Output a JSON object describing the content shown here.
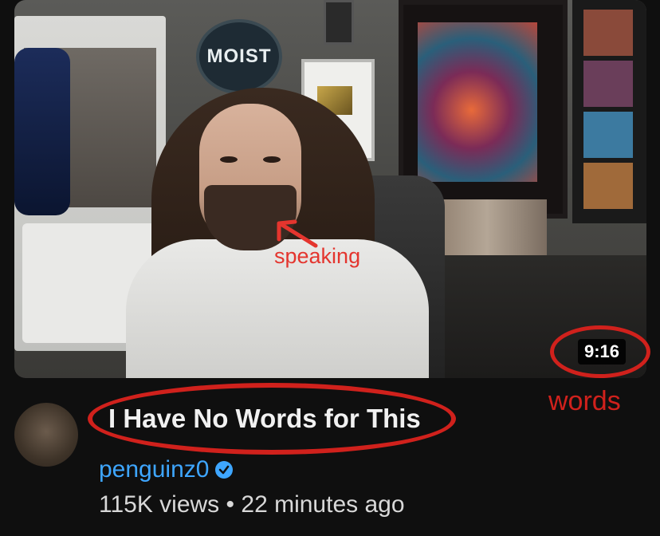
{
  "video": {
    "duration": "9:16",
    "title": "I Have No Words for This",
    "channel": "penguinz0",
    "views": "115K views",
    "separator": "•",
    "posted": "22 minutes ago"
  },
  "thumbnail": {
    "logo_text": "MOIST"
  },
  "annotations": {
    "speaking_label": "speaking",
    "words_label": "words",
    "highlight_color": "#d0211c"
  },
  "colors": {
    "background": "#0f0f0f",
    "channel_link": "#3ea6ff",
    "title_text": "#f1f1f1"
  },
  "icons": {
    "verified": "verified-check-icon",
    "annotation_arrow": "red-arrow-icon"
  }
}
